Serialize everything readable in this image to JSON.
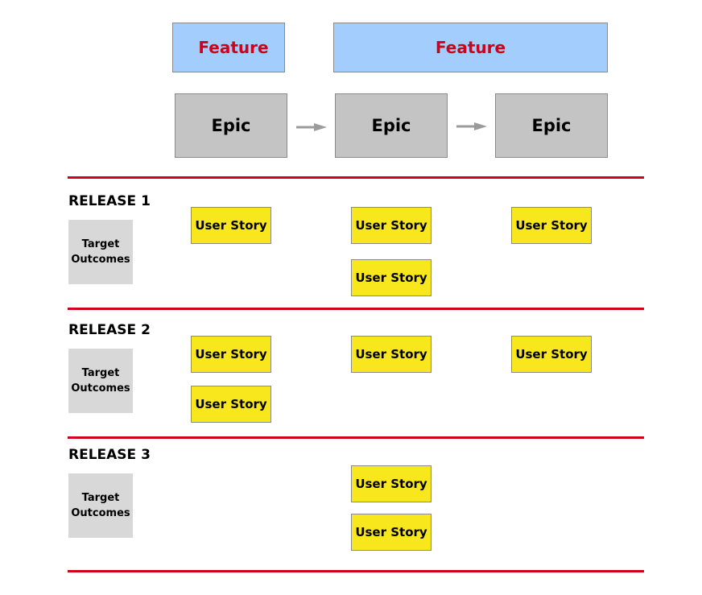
{
  "features": [
    {
      "label": "Feature"
    },
    {
      "label": "Feature"
    }
  ],
  "epics": [
    {
      "label": "Epic"
    },
    {
      "label": "Epic"
    },
    {
      "label": "Epic"
    }
  ],
  "releases": [
    {
      "label": "RELEASE 1",
      "target_outcomes": "Target Outcomes",
      "columns": [
        [
          "User Story"
        ],
        [
          "User Story",
          "User Story"
        ],
        [
          "User Story"
        ]
      ]
    },
    {
      "label": "RELEASE 2",
      "target_outcomes": "Target Outcomes",
      "columns": [
        [
          "User Story",
          "User Story"
        ],
        [
          "User Story"
        ],
        [
          "User Story"
        ]
      ]
    },
    {
      "label": "RELEASE 3",
      "target_outcomes": "Target Outcomes",
      "columns": [
        [],
        [
          "User Story",
          "User Story"
        ],
        []
      ]
    }
  ],
  "colors": {
    "feature_fill": "#a3cdfc",
    "feature_text": "#d0021b",
    "epic_fill": "#c4c4c5",
    "story_fill": "#f8e71c",
    "outcome_fill": "#d8d8d8",
    "divider": "#d0021b",
    "arrow": "#9b9b9b"
  }
}
